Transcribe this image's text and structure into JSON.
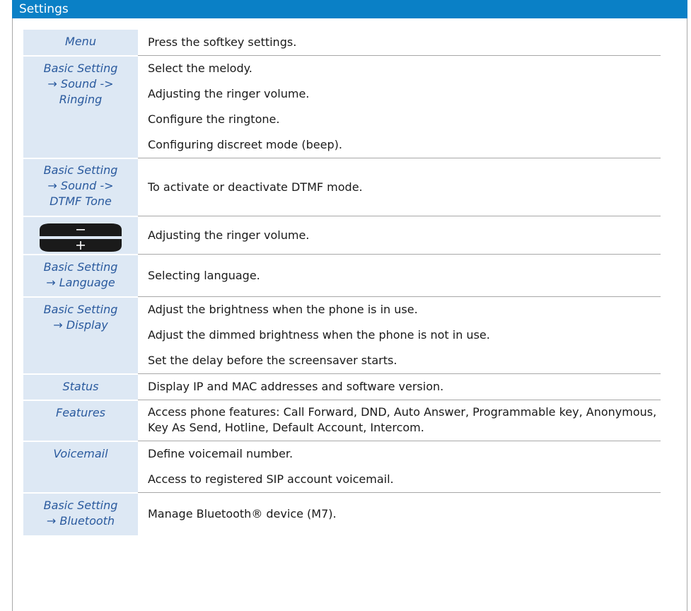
{
  "section_title": "Settings",
  "rows": [
    {
      "key": [
        "Menu"
      ],
      "lines": [
        "Press the softkey settings."
      ]
    },
    {
      "key": [
        "Basic Setting",
        "→ Sound ->",
        "Ringing"
      ],
      "lines": [
        "Select the melody.",
        "Adjusting the ringer volume.",
        "Configure the ringtone.",
        "Configuring discreet mode (beep)."
      ]
    },
    {
      "key": [
        "Basic Setting",
        "→ Sound ->",
        "DTMF Tone"
      ],
      "lines": [
        "To activate or deactivate DTMF mode."
      ]
    },
    {
      "key_icon": "volume-minus-plus-key-icon",
      "lines": [
        "Adjusting the ringer volume."
      ]
    },
    {
      "key": [
        "Basic Setting",
        "→ Language"
      ],
      "lines": [
        "Selecting language."
      ]
    },
    {
      "key": [
        "Basic Setting",
        "→ Display"
      ],
      "lines": [
        "Adjust the brightness when the phone is in use.",
        "Adjust the dimmed brightness when the phone is not in use.",
        "Set the delay before the screensaver starts."
      ]
    },
    {
      "key": [
        "Status"
      ],
      "lines": [
        "Display IP and MAC addresses and software version."
      ]
    },
    {
      "key": [
        "Features"
      ],
      "lines": [
        "Access phone features: Call Forward, DND, Auto Answer, Programmable key, Anonymous, Key As Send, Hotline, Default Account, Intercom."
      ]
    },
    {
      "key": [
        "Voicemail"
      ],
      "lines": [
        "Define voicemail number.",
        "Access to registered SIP account voicemail."
      ]
    },
    {
      "key": [
        "Basic Setting",
        "→ Bluetooth"
      ],
      "lines": [
        "Manage Bluetooth® device (M7)."
      ]
    }
  ],
  "colors": {
    "header_bg": "#0a80c6",
    "key_cell_bg": "#dde8f4",
    "key_text": "#2a5a9e"
  }
}
